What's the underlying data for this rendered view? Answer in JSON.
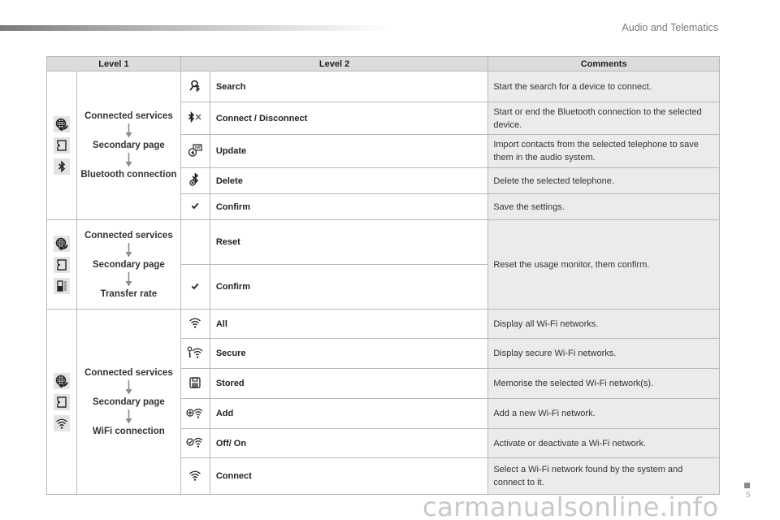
{
  "header": {
    "section_title": "Audio and Telematics"
  },
  "table": {
    "columns": [
      "Level 1",
      "Level 2",
      "Comments"
    ],
    "groups": [
      {
        "level1_icons": [
          "connected-services-icon",
          "secondary-page-icon",
          "bluetooth-icon"
        ],
        "level1_path": [
          "Connected services",
          "Secondary page",
          "Bluetooth connection"
        ],
        "rows": [
          {
            "icon": "bluetooth-search-icon",
            "label": "Search",
            "comment": "Start the search for a device to connect."
          },
          {
            "icon": "bluetooth-connect-icon",
            "label": "Connect / Disconnect",
            "comment": "Start or end the Bluetooth connection to the selected device."
          },
          {
            "icon": "contacts-update-icon",
            "label": "Update",
            "comment": "Import contacts from the selected telephone to save them in the audio system."
          },
          {
            "icon": "bluetooth-delete-icon",
            "label": "Delete",
            "comment": "Delete the selected telephone."
          },
          {
            "icon": "checkmark-icon",
            "label": "Confirm",
            "comment": "Save the settings."
          }
        ]
      },
      {
        "level1_icons": [
          "connected-services-icon",
          "secondary-page-icon",
          "transfer-rate-icon"
        ],
        "level1_path": [
          "Connected services",
          "Secondary page",
          "Transfer rate"
        ],
        "rows": [
          {
            "icon": "",
            "label": "Reset",
            "comment": "Reset the usage monitor, them confirm."
          },
          {
            "icon": "checkmark-icon",
            "label": "Confirm",
            "comment": ""
          }
        ]
      },
      {
        "level1_icons": [
          "connected-services-icon",
          "secondary-page-icon",
          "wifi-icon"
        ],
        "level1_path": [
          "Connected services",
          "Secondary page",
          "WiFi connection"
        ],
        "rows": [
          {
            "icon": "wifi-icon",
            "label": "All",
            "comment": "Display all Wi-Fi networks."
          },
          {
            "icon": "wifi-secure-icon",
            "label": "Secure",
            "comment": "Display secure Wi-Fi networks."
          },
          {
            "icon": "save-disk-icon",
            "label": "Stored",
            "comment": "Memorise the selected Wi-Fi network(s)."
          },
          {
            "icon": "wifi-add-icon",
            "label": "Add",
            "comment": "Add a new Wi-Fi network."
          },
          {
            "icon": "wifi-toggle-icon",
            "label": "Off/ On",
            "comment": "Activate or deactivate a Wi-Fi network."
          },
          {
            "icon": "wifi-icon",
            "label": "Connect",
            "comment": "Select a Wi-Fi network found by the system and connect to it."
          }
        ]
      }
    ]
  },
  "footer": {
    "watermark": "carmanualsonline.info",
    "page_number": "5"
  }
}
